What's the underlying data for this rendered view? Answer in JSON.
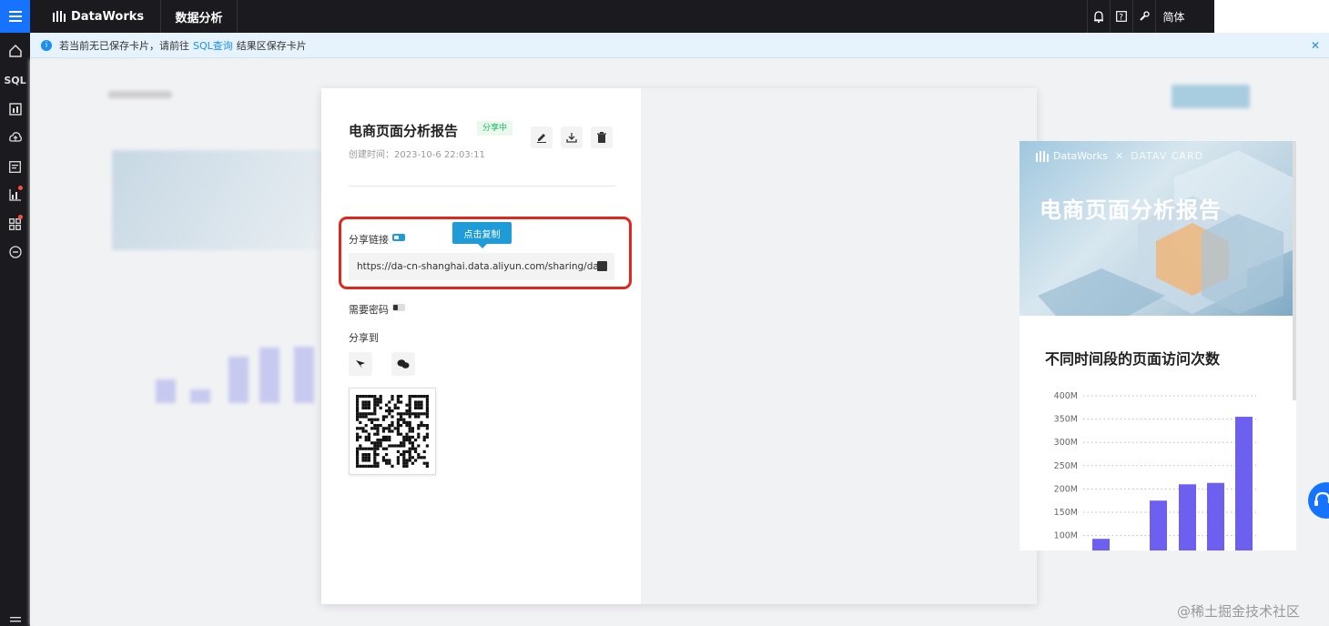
{
  "topbar": {
    "brand": "DataWorks",
    "module": "数据分析",
    "lang": "简体"
  },
  "notice": {
    "text_before": "若当前无已保存卡片，请前往",
    "link": "SQL查询",
    "text_after": "结果区保存卡片"
  },
  "leftnav": {
    "items": [
      "home-icon",
      "sql-icon",
      "chart-icon",
      "upload-icon",
      "list-icon",
      "bar-chart-icon",
      "apps-icon",
      "more-icon"
    ],
    "sql_label": "SQL"
  },
  "share": {
    "title": "电商页面分析报告",
    "status": "分享中",
    "created": "创建时间：2023-10-6 22:03:11",
    "share_link_label": "分享链接",
    "tooltip": "点击复制",
    "url": "https://da-cn-shanghai.data.aliyun.com/sharing/da",
    "need_password_label": "需要密码",
    "share_to_label": "分享到"
  },
  "preview": {
    "brand": "DataWorks",
    "partner": "DATAV CARD",
    "banner_title": "电商页面分析报告",
    "chart_title": "不同时间段的页面访问次数"
  },
  "chart_data": {
    "type": "bar",
    "title": "不同时间段的页面访问次数",
    "y_ticks": [
      "400M",
      "350M",
      "300M",
      "250M",
      "200M",
      "150M",
      "100M"
    ],
    "ylim": [
      100,
      400
    ],
    "values": [
      93,
      175,
      210,
      213,
      355
    ],
    "grid": true,
    "color": "#6d5ff0"
  },
  "colors": {
    "accent": "#1673ff",
    "bar": "#6d5ff0",
    "highlight": "#e0271c",
    "status": "#23b25e"
  },
  "watermark": "@稀土掘金技术社区"
}
